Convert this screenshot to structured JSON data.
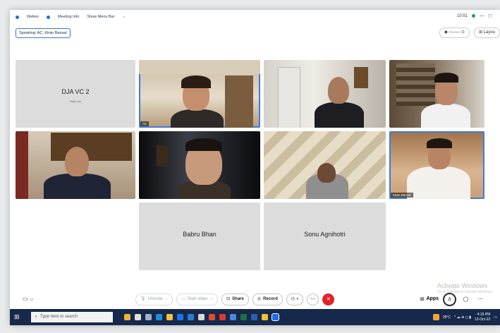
{
  "menubar": {
    "webex": "Webex",
    "meeting_info": "Meeting Info",
    "show_menu_bar": "Show Menu Bar"
  },
  "clock": "10:51",
  "speaking": "Speaking: AC, Kiran Bansal",
  "layout_label": "Layou",
  "tiles": {
    "dja": {
      "name": "DJA VC 2",
      "sub": "Host, me"
    },
    "ac": {
      "tag": "AC"
    },
    "kiran": {
      "tag": "Kiran Bansal"
    },
    "babru": {
      "name": "Babru Bhan"
    },
    "sonu": {
      "name": "Sonu Agnihotri"
    }
  },
  "controls": {
    "unmute": "Unmute",
    "start_video": "Start video",
    "share": "Share",
    "record": "Record",
    "apps": "Apps"
  },
  "activate": {
    "title": "Activate Windows",
    "sub": "Go to Settings to activate Windows."
  },
  "taskbar": {
    "search": "Type here to search",
    "temp": "28°C",
    "time": "4:16 PM",
    "date": "13-Oct-22"
  },
  "colors": {
    "accent": "#3d7be0",
    "leave": "#e0242c",
    "taskbar": "#16294a"
  }
}
